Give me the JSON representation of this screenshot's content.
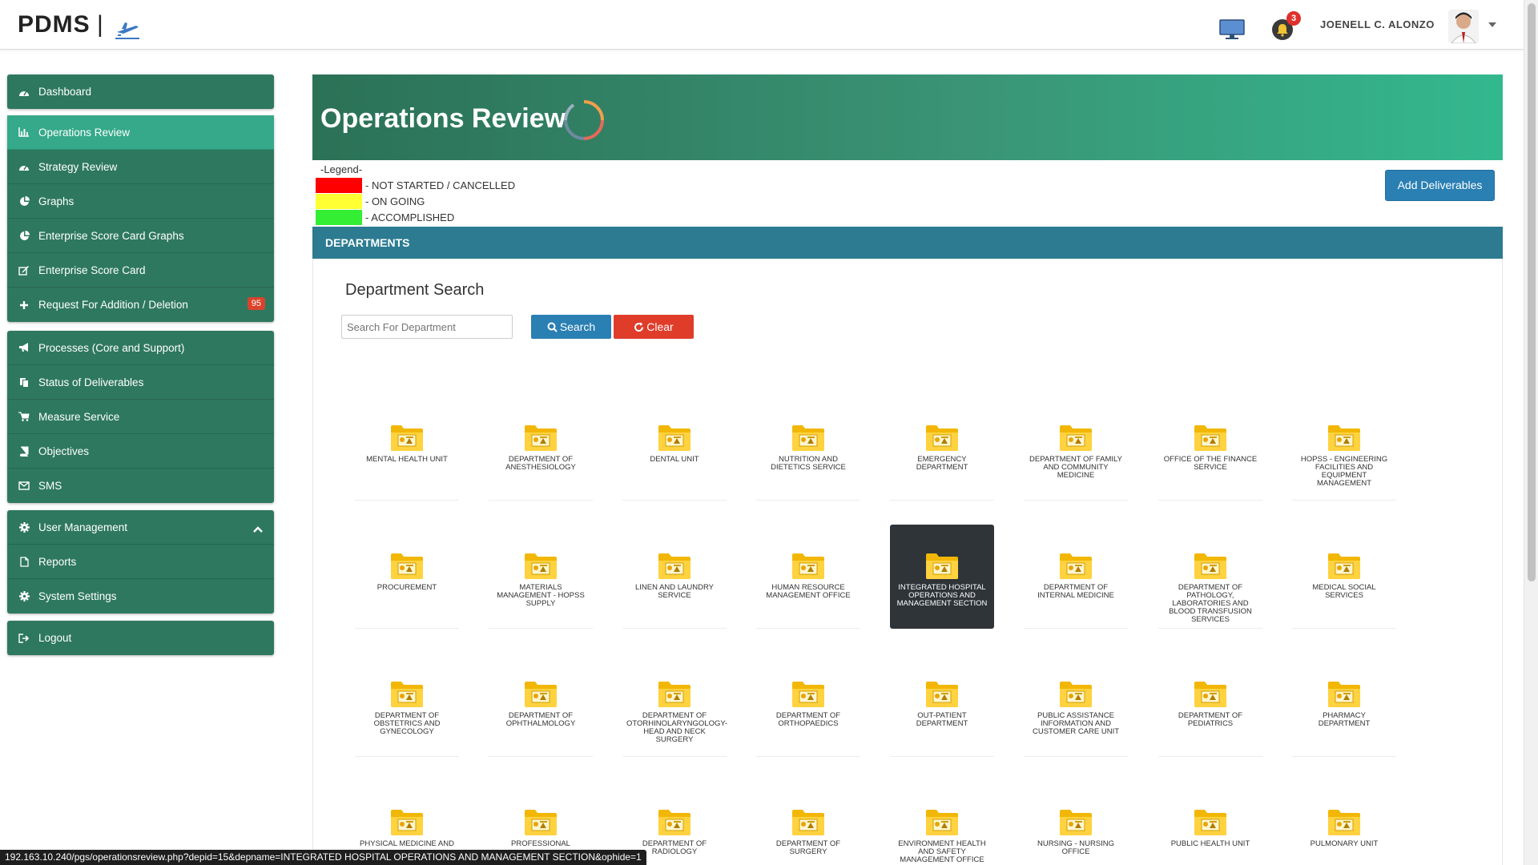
{
  "app": {
    "brand": "PDMS",
    "separator": "|"
  },
  "header": {
    "notifications_count": "3",
    "username": "JOENELL C. ALONZO"
  },
  "sidebar": {
    "groups": [
      [
        {
          "label": "Dashboard",
          "icon": "dashboard-icon"
        }
      ],
      [
        {
          "label": "Operations Review",
          "icon": "bar-chart-icon",
          "active": true
        },
        {
          "label": "Strategy Review",
          "icon": "dashboard-icon"
        },
        {
          "label": "Graphs",
          "icon": "pie-chart-icon"
        },
        {
          "label": "Enterprise Score Card Graphs",
          "icon": "pie-chart-icon"
        },
        {
          "label": "Enterprise Score Card",
          "icon": "edit-icon"
        },
        {
          "label": "Request For Addition / Deletion",
          "icon": "plus-icon",
          "badge": "95"
        }
      ],
      [
        {
          "label": "Processes (Core and Support)",
          "icon": "bullhorn-icon"
        },
        {
          "label": "Status of Deliverables",
          "icon": "copy-icon"
        },
        {
          "label": "Measure Service",
          "icon": "cart-icon"
        },
        {
          "label": "Objectives",
          "icon": "book-icon"
        },
        {
          "label": "SMS",
          "icon": "envelope-icon"
        }
      ],
      [
        {
          "label": "User Management",
          "icon": "gear-icon",
          "expanded": true
        },
        {
          "label": "Reports",
          "icon": "file-icon"
        },
        {
          "label": "System Settings",
          "icon": "gear-icon"
        }
      ],
      [
        {
          "label": "Logout",
          "icon": "logout-icon"
        }
      ]
    ]
  },
  "hero": {
    "title": "Operations Review"
  },
  "legend": {
    "title": "-Legend-",
    "items": [
      {
        "label": "- NOT STARTED / CANCELLED",
        "color": "#ff0000"
      },
      {
        "label": "- ON GOING",
        "color": "#ffff33"
      },
      {
        "label": "- ACCOMPLISHED",
        "color": "#33ee33"
      }
    ]
  },
  "actions": {
    "add_deliverables": "Add Deliverables"
  },
  "departments": {
    "header": "DEPARTMENTS",
    "search_title": "Department Search",
    "search_placeholder": "Search For Department",
    "search_button": "Search",
    "clear_button": "Clear",
    "selected": "INTEGRATED HOSPITAL OPERATIONS AND MANAGEMENT SECTION",
    "items": [
      "MENTAL HEALTH UNIT",
      "DEPARTMENT OF ANESTHESIOLOGY",
      "DENTAL UNIT",
      "NUTRITION AND DIETETICS SERVICE",
      "EMERGENCY DEPARTMENT",
      "DEPARTMENT OF FAMILY AND COMMUNITY MEDICINE",
      "OFFICE OF THE FINANCE SERVICE",
      "HOPSS - ENGINEERING FACILITIES AND EQUIPMENT MANAGEMENT",
      "PROCUREMENT",
      "MATERIALS MANAGEMENT - HOPSS SUPPLY",
      "LINEN AND LAUNDRY SERVICE",
      "HUMAN RESOURCE MANAGEMENT OFFICE",
      "INTEGRATED HOSPITAL OPERATIONS AND MANAGEMENT SECTION",
      "DEPARTMENT OF INTERNAL MEDICINE",
      "DEPARTMENT OF PATHOLOGY, LABORATORIES AND BLOOD TRANSFUSION SERVICES",
      "MEDICAL SOCIAL SERVICES",
      "DEPARTMENT OF OBSTETRICS AND GYNECOLOGY",
      "DEPARTMENT OF OPHTHALMOLOGY",
      "DEPARTMENT OF OTORHINOLARYNGOLOGY-HEAD AND NECK SURGERY",
      "DEPARTMENT OF ORTHOPAEDICS",
      "OUT-PATIENT DEPARTMENT",
      "PUBLIC ASSISTANCE INFORMATION AND CUSTOMER CARE UNIT",
      "DEPARTMENT OF PEDIATRICS",
      "PHARMACY DEPARTMENT",
      "PHYSICAL MEDICINE AND",
      "PROFESSIONAL",
      "DEPARTMENT OF RADIOLOGY",
      "DEPARTMENT OF SURGERY",
      "ENVIRONMENT HEALTH AND SAFETY MANAGEMENT OFFICE",
      "NURSING - NURSING OFFICE",
      "PUBLIC HEALTH UNIT",
      "PULMONARY UNIT"
    ]
  },
  "status_url": "192.163.10.240/pgs/operationsreview.php?depid=15&depname=INTEGRATED HOSPITAL OPERATIONS AND MANAGEMENT SECTION&ophide=1"
}
